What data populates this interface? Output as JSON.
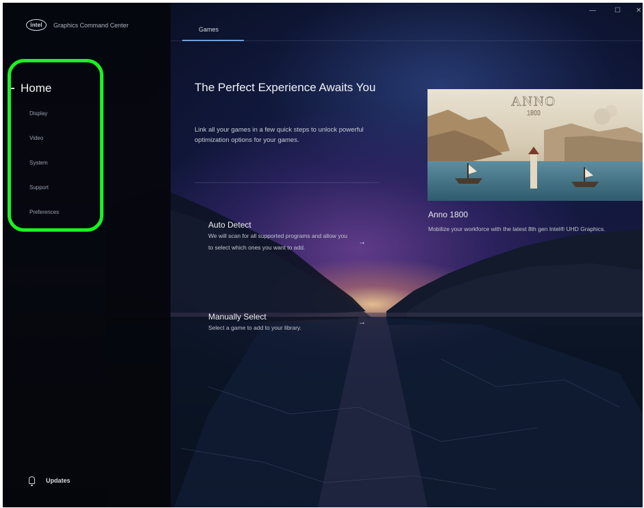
{
  "app": {
    "brand_logo": "intel",
    "brand_name": "Graphics Command Center"
  },
  "window_controls": {
    "minimize": "—",
    "maximize": "☐",
    "close": "✕"
  },
  "sidebar": {
    "home_label": "Home",
    "items": [
      {
        "label": "Display"
      },
      {
        "label": "Video"
      },
      {
        "label": "System"
      },
      {
        "label": "Support"
      },
      {
        "label": "Preferences"
      }
    ],
    "updates_label": "Updates"
  },
  "tabs": [
    {
      "label": "Games",
      "active": true
    }
  ],
  "hero": {
    "title": "The Perfect Experience Awaits You",
    "description": "Link all your games in a few quick steps to unlock powerful optimization options for your games."
  },
  "options": [
    {
      "title": "Auto Detect",
      "description": "We will scan for all supported programs and allow you to select which ones you want to add.",
      "arrow": "→"
    },
    {
      "title": "Manually Select",
      "description": "Select a game to add to your library.",
      "arrow": "→"
    }
  ],
  "featured": {
    "image_logo_text": "ANNO",
    "image_logo_subtext": "1800",
    "title": "Anno 1800",
    "description": "Mobilize your workforce with the latest 8th gen Intel® UHD Graphics."
  },
  "colors": {
    "highlight_ring": "#19f223",
    "tab_underline": "#6fa0d8",
    "sidebar_bg": "#05070c"
  }
}
